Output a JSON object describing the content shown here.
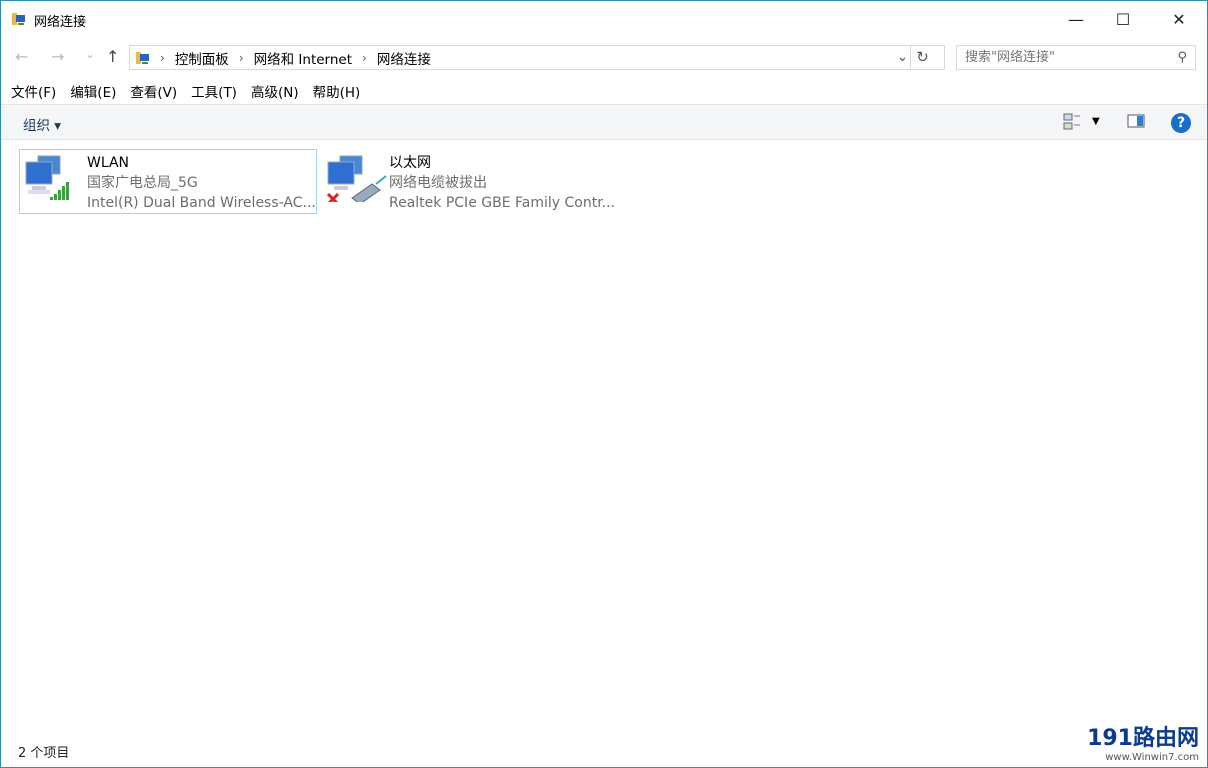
{
  "window": {
    "title": "网络连接",
    "minimize": "—",
    "maximize": "☐",
    "close": "✕"
  },
  "nav": {
    "back": "←",
    "forward": "→",
    "recent": "⌄",
    "up": "↑",
    "breadcrumb": [
      "控制面板",
      "网络和 Internet",
      "网络连接"
    ],
    "search_placeholder": "搜索\"网络连接\""
  },
  "menu": [
    "文件(F)",
    "编辑(E)",
    "查看(V)",
    "工具(T)",
    "高级(N)",
    "帮助(H)"
  ],
  "toolbar": {
    "organize": "组织 ▾",
    "help": "?"
  },
  "connections": [
    {
      "name": "WLAN",
      "status": "国家广电总局_5G",
      "adapter": "Intel(R) Dual Band Wireless-AC...",
      "type": "wireless",
      "selected": true
    },
    {
      "name": "以太网",
      "status": "网络电缆被拔出",
      "adapter": "Realtek PCIe GBE Family Contr...",
      "type": "ethernet-disconnected",
      "selected": false
    }
  ],
  "statusbar": {
    "count": "2 个项目"
  },
  "watermark": {
    "brand": "191路由网",
    "url": "www.Winwin7.com"
  }
}
